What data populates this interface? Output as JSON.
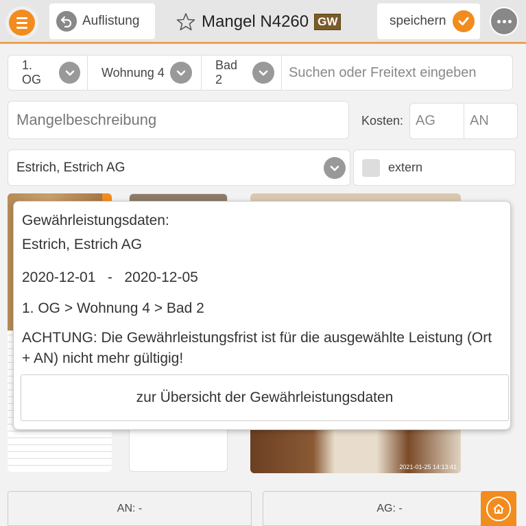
{
  "header": {
    "back_label": "Auflistung",
    "title": "Mangel N4260",
    "badge": "GW",
    "save_label": "speichern"
  },
  "location": {
    "floor": "1. OG",
    "unit": "Wohnung 4",
    "room": "Bad 2",
    "search_placeholder": "Suchen oder Freitext eingeben"
  },
  "form": {
    "description_placeholder": "Mangelbeschreibung",
    "cost_label": "Kosten:",
    "cost_ag_placeholder": "AG",
    "cost_an_placeholder": "AN",
    "company": "Estrich, Estrich AG",
    "extern_label": "extern"
  },
  "photos": {
    "timestamp": "2021-01-25 14:13:41"
  },
  "popup": {
    "heading": "Gewährleistungsdaten:",
    "company": "Estrich, Estrich AG",
    "dates": "2020-12-01   -   2020-12-05",
    "path": "1. OG > Wohnung 4 > Bad 2",
    "warning": "ACHTUNG: Die Gewährleistungsfrist ist für die ausgewählte Leistung (Ort + AN) nicht mehr gültigig!",
    "button_label": "zur Übersicht der Gewährleistungsdaten"
  },
  "footer": {
    "an_label": "AN: -",
    "ag_label": "AG: -"
  },
  "colors": {
    "accent": "#f28c1e",
    "badge": "#7a5c2a"
  },
  "icons": [
    "menu-icon",
    "back-arrow-icon",
    "star-icon",
    "check-icon",
    "more-icon",
    "chevron-down-icon",
    "home-icon"
  ]
}
